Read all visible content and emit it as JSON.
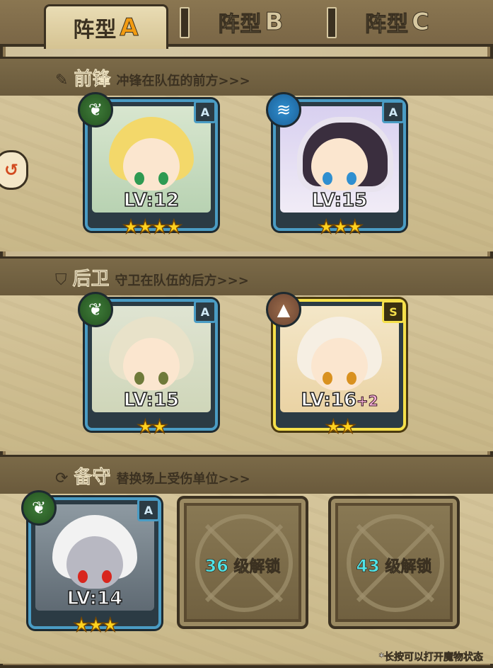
{
  "tabs": [
    {
      "label": "阵型",
      "letter": "A",
      "active": true
    },
    {
      "label": "阵型",
      "letter": "B",
      "active": false
    },
    {
      "label": "阵型",
      "letter": "C",
      "active": false
    }
  ],
  "sections": {
    "front": {
      "title": "前锋",
      "desc": "冲锋在队伍的前方>>>",
      "icon": "sword-icon"
    },
    "back": {
      "title": "后卫",
      "desc": "守卫在队伍的后方>>>",
      "icon": "shield-icon"
    },
    "reserve": {
      "title": "备守",
      "desc": "替换场上受伤单位>>>",
      "icon": "swap-icon"
    }
  },
  "units": {
    "front_1": {
      "level": "LV:12",
      "plus": "",
      "stars": "★★★★",
      "rank": "A",
      "element": "nature-icon"
    },
    "front_2": {
      "level": "LV:15",
      "plus": "",
      "stars": "★★★",
      "rank": "A",
      "element": "water-icon"
    },
    "back_1": {
      "level": "LV:15",
      "plus": "",
      "stars": "★★",
      "rank": "A",
      "element": "nature-icon"
    },
    "back_2": {
      "level": "LV:16",
      "plus": "+2",
      "stars": "★★",
      "rank": "S",
      "element": "earth-icon"
    },
    "reserve_1": {
      "level": "LV:14",
      "plus": "",
      "stars": "★★★",
      "rank": "A",
      "element": "nature-icon"
    }
  },
  "locked": [
    {
      "level": "36",
      "text": "级解锁"
    },
    {
      "level": "43",
      "text": "级解锁"
    }
  ],
  "hint": "*长按可以打开魔物状态"
}
